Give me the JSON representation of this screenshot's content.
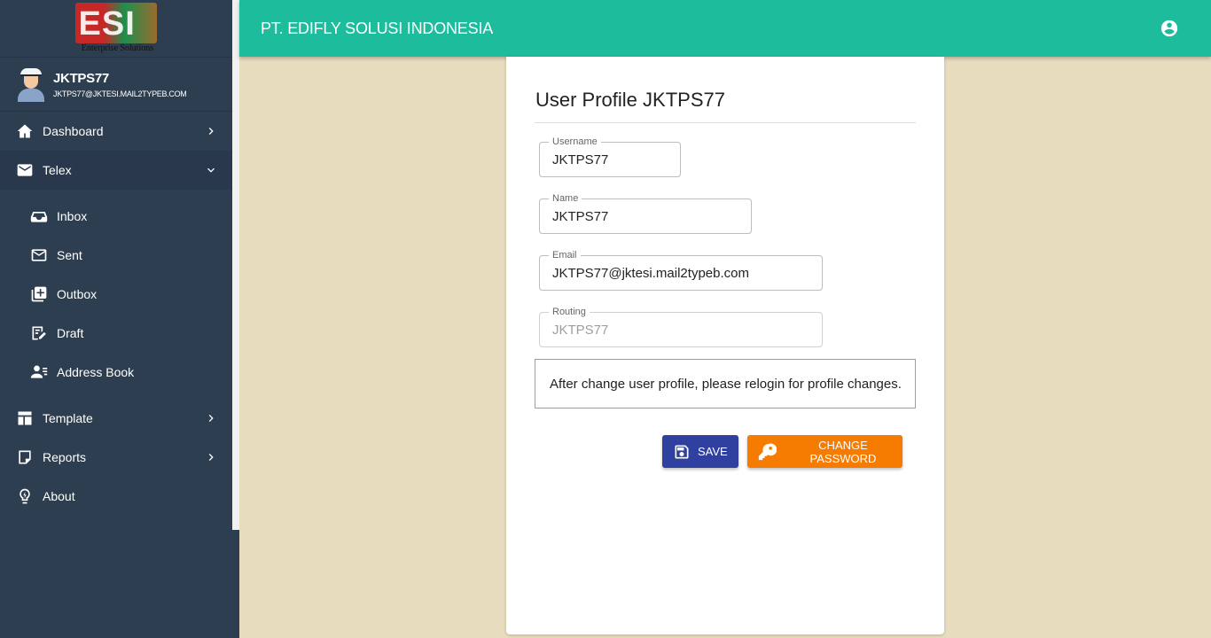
{
  "brand": {
    "logo_letters": "ESI",
    "logo_tagline": "Enterprise Solutions"
  },
  "user": {
    "name": "JKTPS77",
    "email": "JKTPS77@JKTESI.MAIL2TYPEB.COM"
  },
  "sidebar": {
    "items": [
      {
        "label": "Dashboard",
        "icon": "home-icon"
      },
      {
        "label": "Telex",
        "icon": "envelope-icon"
      },
      {
        "label": "Inbox",
        "icon": "inbox-icon"
      },
      {
        "label": "Sent",
        "icon": "mail-outline-icon"
      },
      {
        "label": "Outbox",
        "icon": "library-add-icon"
      },
      {
        "label": "Draft",
        "icon": "edit-note-icon"
      },
      {
        "label": "Address Book",
        "icon": "contacts-icon"
      },
      {
        "label": "Template",
        "icon": "layout-icon"
      },
      {
        "label": "Reports",
        "icon": "note-icon"
      },
      {
        "label": "About",
        "icon": "lightbulb-icon"
      }
    ]
  },
  "header": {
    "company": "PT. EDIFLY SOLUSI INDONESIA"
  },
  "profile": {
    "title": "User Profile JKTPS77",
    "username": {
      "label": "Username",
      "value": "JKTPS77"
    },
    "name": {
      "label": "Name",
      "value": "JKTPS77"
    },
    "email": {
      "label": "Email",
      "value": "JKTPS77@jktesi.mail2typeb.com"
    },
    "routing": {
      "label": "Routing",
      "value": "JKTPS77"
    },
    "notice": "After change user profile, please relogin for profile changes.",
    "save_label": "SAVE",
    "change_password_label": "CHANGE PASSWORD"
  },
  "colors": {
    "sidebar": "#2d3e50",
    "header": "#1dbc9c",
    "background": "#e8dcbf",
    "save": "#3040a0",
    "change_password": "#f57c00"
  }
}
